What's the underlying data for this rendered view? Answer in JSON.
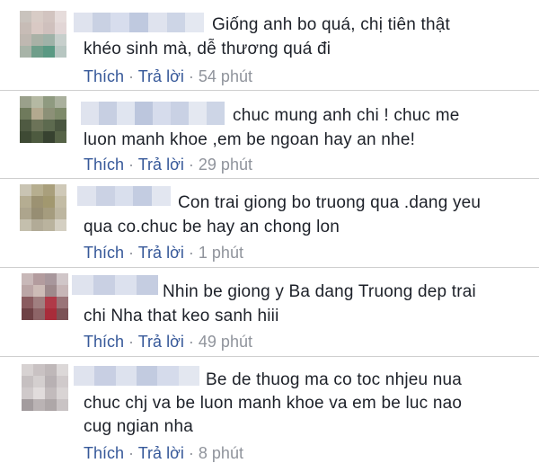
{
  "comments": [
    {
      "lines": [
        "Giống anh bo quá, chị tiên thật",
        "khéo sinh mà, dễ thương quá đi"
      ],
      "like_label": "Thích",
      "reply_label": "Trả lời",
      "separator": "·",
      "time": "54 phút"
    },
    {
      "lines": [
        "chuc mung anh chi ! chuc me",
        "luon manh khoe ,em be ngoan hay an nhe!"
      ],
      "like_label": "Thích",
      "reply_label": "Trả lời",
      "separator": "·",
      "time": "29 phút"
    },
    {
      "lines": [
        "Con trai giong bo truong qua .dang yeu",
        "qua co.chuc be hay an chong lon"
      ],
      "like_label": "Thích",
      "reply_label": "Trả lời",
      "separator": "·",
      "time": "1 phút"
    },
    {
      "lines": [
        "Nhin be giong y Ba dang Truong dep trai",
        "chi Nha that keo sanh hiii"
      ],
      "like_label": "Thích",
      "reply_label": "Trả lời",
      "separator": "·",
      "time": "49 phút"
    },
    {
      "lines": [
        "Be de thuog ma co toc nhjeu nua",
        "chuc chj va be luon manh khoe va em be luc nao",
        "cug ngian nha"
      ],
      "like_label": "Thích",
      "reply_label": "Trả lời",
      "separator": "·",
      "time": "8 phút"
    }
  ],
  "colors": {
    "link": "#365899",
    "meta_gray": "#90949c",
    "text": "#1d2129",
    "divider": "#cfcfcf"
  }
}
